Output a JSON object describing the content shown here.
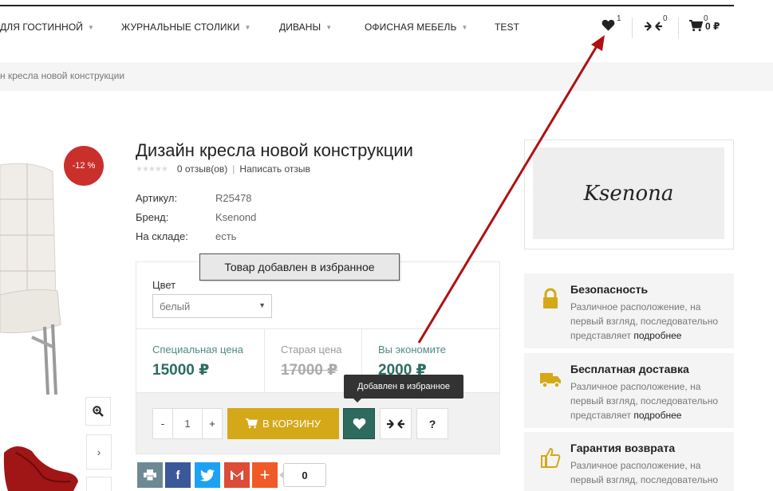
{
  "nav": {
    "items": [
      {
        "label": "для гостинной",
        "caret": true
      },
      {
        "label": "Журнальные столики",
        "caret": true
      },
      {
        "label": "Диваны",
        "caret": true
      },
      {
        "label": "Офисная мебель",
        "caret": true
      },
      {
        "label": "TEST",
        "caret": false
      }
    ],
    "wishlist_count": "1",
    "compare_count": "0",
    "cart_count": "0",
    "cart_total": "0 ₽"
  },
  "breadcrumb": "н кресла новой конструкции",
  "product": {
    "discount_badge": "-12 %",
    "title": "Дизайн кресла новой конструкции",
    "reviews": "0 отзыв(ов)",
    "write_review": "Написать отзыв",
    "specs": [
      {
        "label": "Артикул:",
        "value": "R25478"
      },
      {
        "label": "Бренд:",
        "value": "Ksenond"
      },
      {
        "label": "На складе:",
        "value": "есть"
      }
    ],
    "option_label": "Цвет",
    "option_selected": "белый",
    "toast": "Товар добавлен в избранное",
    "prices": {
      "special_label": "Специальная цена",
      "special_value": "15000 ₽",
      "old_label": "Старая цена",
      "old_value": "17000 ₽",
      "save_label": "Вы экономите",
      "save_value": "2000 ₽"
    },
    "qty_minus": "-",
    "qty_value": "1",
    "qty_plus": "+",
    "add_to_cart": "В корзину",
    "question_button": "?",
    "tooltip": "Добавлен в избранное",
    "share_count": "0"
  },
  "brand_logo": "Ksenona",
  "features": [
    {
      "title": "Безопасность",
      "text": "Различное расположение, на первый взгляд, последовательно представляет",
      "link": "подробнее",
      "icon": "lock-icon"
    },
    {
      "title": "Бесплатная доставка",
      "text": "Различное расположение, на первый взгляд, последовательно представляет",
      "link": "подробнее",
      "icon": "truck-icon"
    },
    {
      "title": "Гарантия возврата",
      "text": "Различное расположение, на первый взгляд, последовательно",
      "link": "",
      "icon": "thumbs-up-icon"
    }
  ],
  "colors": {
    "accent_gold": "#d4a818",
    "price_green": "#2c6d62",
    "badge_red": "#c9302c",
    "arrow_red": "#b01010",
    "facebook": "#3b5998",
    "twitter": "#1da1f2",
    "gmail": "#dd4b39",
    "share_plus": "#f05a28",
    "print": "#6d8a94"
  }
}
